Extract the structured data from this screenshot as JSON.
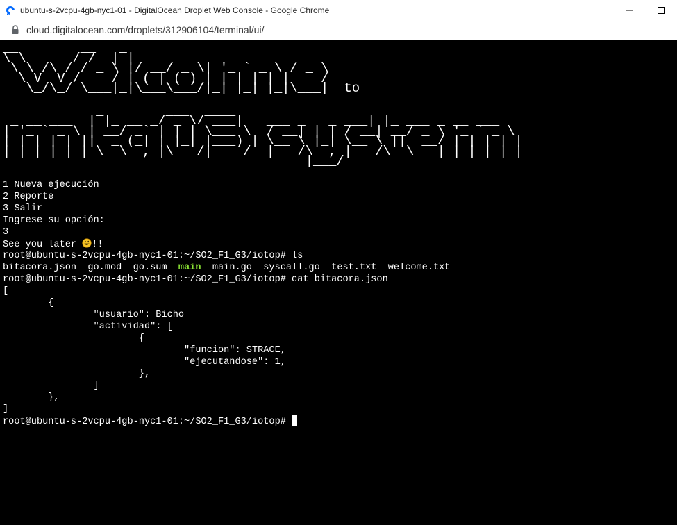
{
  "window": {
    "title": "ubuntu-s-2vcpu-4gb-nyc1-01 - DigitalOcean Droplet Web Console - Google Chrome",
    "favicon": "digitalocean-icon",
    "controls": {
      "minimize": "minimize-icon",
      "maximize": "maximize-icon"
    }
  },
  "address": {
    "url": "cloud.digitalocean.com/droplets/312906104/terminal/ui/",
    "lock_icon": "lock-icon"
  },
  "terminal": {
    "banner_welcome": "__        __   _\n\\ \\      / /__| | ___ ___  _ __ ___   ___\n \\ \\ /\\ / / _ \\ |/ __/ _ \\| '_ ` _ \\ / _ \\\n  \\ V  V /  __/ | (_| (_) | | | | | |  __/\n   \\_/\\_/ \\___|_|\\___\\___/|_| |_| |_|\\___|  to",
    "banner_system": "            _        ___  ____\n _ __ ___  | |_ __ _/ _ \\/ ___|   ___ _   _ ___| |_ ___ _ __ ___\n| '_ ` _ \\ | __/ _` | | | \\___ \\  / __| | | / __| __/ _ \\ '_ ` _ \\\n| | | | | ||  _ (_| | |_| |___) | \\__ \\ |_| \\__ \\ ||  __/ | | | | |\n|_| |_| |_| \\__\\__,_|\\___/|____/  |___/\\__, |___/\\__\\___|_| |_| |_|\n                                       |___/",
    "menu": [
      "1 Nueva ejecución",
      "2 Reporte",
      "3 Salir"
    ],
    "prompt_option": "Ingrese su opción:",
    "input_option": "3",
    "goodbye_text": "See you later ",
    "goodbye_suffix": "!!",
    "emoji_icon": "grinning-face-icon",
    "prompt": "root@ubuntu-s-2vcpu-4gb-nyc1-01:~/SO2_F1_G3/iotop#",
    "cmd_ls": " ls",
    "ls_files": {
      "f1": "bitacora.json  go.mod  go.sum  ",
      "dir": "main",
      "f2": "  main.go  syscall.go  test.txt  welcome.txt"
    },
    "cmd_cat": " cat bitacora.json",
    "json_lines": [
      "[",
      "        {",
      "                \"usuario\": Bicho",
      "                \"actividad\": [",
      "                        {",
      "                                \"funcion\": STRACE,",
      "                                \"ejecutandose\": 1,",
      "                        },",
      "                ]",
      "        },",
      "]"
    ],
    "final_prompt": "root@ubuntu-s-2vcpu-4gb-nyc1-01:~/SO2_F1_G3/iotop# "
  },
  "colors": {
    "terminal_bg": "#000000",
    "terminal_fg": "#ffffff",
    "directory": "#8ae234",
    "favicon_blue": "#0069ff"
  }
}
